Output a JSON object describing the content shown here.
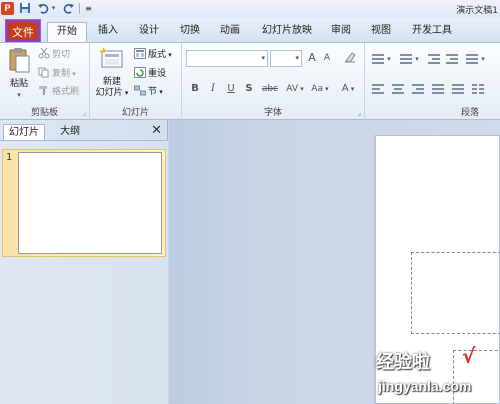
{
  "quick_access": {
    "app_icon": "powerpoint-logo",
    "buttons": [
      "save-icon",
      "undo-icon",
      "redo-icon",
      "customize-icon"
    ],
    "window_title": "演示文稿1"
  },
  "tabs": {
    "file": "文件",
    "items": [
      "开始",
      "插入",
      "设计",
      "切换",
      "动画",
      "幻灯片放映",
      "审阅",
      "视图",
      "开发工具"
    ],
    "active": "开始",
    "file_highlight_color": "#8e3fc9"
  },
  "ribbon": {
    "clipboard": {
      "paste": "粘贴",
      "cut": "剪切",
      "copy": "复制",
      "format_painter": "格式刷",
      "label": "剪贴板"
    },
    "slides": {
      "new_slide_line1": "新建",
      "new_slide_line2": "幻灯片",
      "layout": "版式",
      "reset": "重设",
      "section": "节",
      "label": "幻灯片"
    },
    "font": {
      "grow": "A",
      "shrink": "A",
      "bold": "B",
      "italic": "I",
      "underline": "U",
      "strike": "S",
      "abc": "abc",
      "spacing": "AV",
      "case": "Aa",
      "color": "A",
      "label": "字体"
    },
    "paragraph": {
      "label": "段落"
    }
  },
  "left_panel": {
    "tab_slides": "幻灯片",
    "tab_outline": "大纲",
    "close": "✕",
    "slide_number": "1"
  },
  "watermark": {
    "text": "经验啦",
    "check": "√",
    "url": "jingyanla.com"
  }
}
